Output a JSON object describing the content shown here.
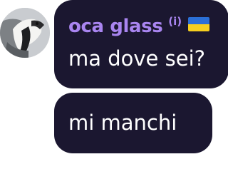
{
  "conversation": {
    "avatar": {
      "icon": "goose-photo-avatar"
    },
    "sender": {
      "name": "oca glass",
      "tag": "(i)",
      "flag_icon": "ukraine-flag-icon",
      "name_color": "#a985f0"
    },
    "messages": [
      {
        "text": "ma dove sei?"
      },
      {
        "text": "mi manchi"
      }
    ],
    "bubble_color": "#1b1730"
  }
}
